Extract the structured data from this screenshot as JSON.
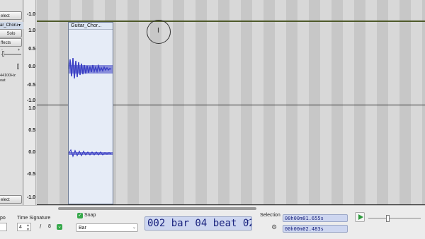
{
  "app": {
    "colors": {
      "waveform": "#3b3fc4",
      "clip_bg": "#e6ecf7",
      "accent_green": "#35a84a",
      "time_digits": "#1a237e"
    }
  },
  "track_panel": {
    "top_button": "elect",
    "track_name": "ar_Choru",
    "solo_label": "Solo",
    "effects_label": "ffects",
    "slider_minus": "-",
    "slider_plus": "+",
    "rate_text": "44100Hz",
    "format_text": "oat",
    "bottom_button": "elect"
  },
  "vertical_ruler": {
    "top_track": {
      "labels": [
        "-1.0"
      ]
    },
    "track1": {
      "labels": [
        "1.0",
        "0.5",
        "0.0",
        "-0.5",
        "-1.0"
      ]
    },
    "track2": {
      "labels": [
        "1.0",
        "0.5",
        "0.0",
        "-0.5",
        "-1.0"
      ]
    }
  },
  "clip": {
    "title": "Guitar_Chor..."
  },
  "toolbar": {
    "tempo_label": "po",
    "time_signature_label": "Time Signature",
    "ts_numerator": "4",
    "ts_separator": "/",
    "ts_denominator": "8",
    "snap_label": "Snap",
    "snap_checked": true,
    "snap_unit": "Bar",
    "beats_display": "002 bar 04 beat 02",
    "selection_label": "Selection",
    "selection_start": "00h00m01.655s",
    "selection_end": "00h00m02.483s"
  }
}
